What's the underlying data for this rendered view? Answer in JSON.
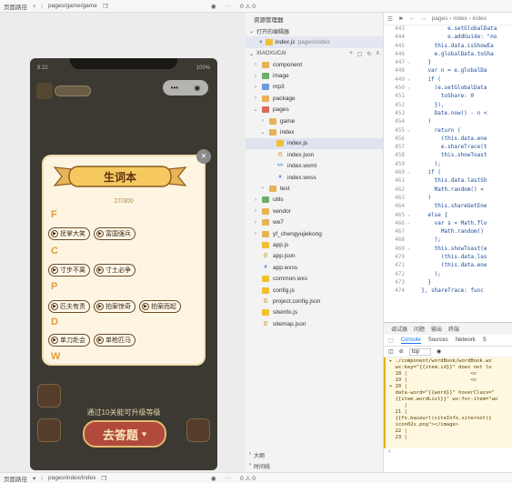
{
  "top_bar": {
    "label": "页面路径",
    "path": "pages/game/game",
    "problems": "0 ⚠ 0"
  },
  "bottom_bar": {
    "label": "页面路径",
    "path": "pages/index/index",
    "problems": "0 ⚠ 0"
  },
  "phone": {
    "time": "8:22",
    "battery": "100%",
    "capsule_menu": "•••",
    "capsule_close": "◉",
    "bottom_text": "通过10关能可升级等级",
    "answer_button": "去答题"
  },
  "vocab_card": {
    "title": "生词本",
    "progress": "27/300",
    "groups": [
      {
        "letter": "F",
        "words": [
          "抚掌大笑",
          "富国强兵"
        ]
      },
      {
        "letter": "C",
        "words": [
          "寸步不离",
          "寸土必争"
        ]
      },
      {
        "letter": "P",
        "words": [
          "匹夫有责",
          "拍案惊奇",
          "拍案而起"
        ]
      },
      {
        "letter": "D",
        "words": [
          "单刀赴会",
          "单枪匹马"
        ]
      },
      {
        "letter": "W",
        "words": []
      }
    ]
  },
  "explorer": {
    "header": "资源管理器",
    "open_editors": "打开的编辑器",
    "open_file_name": "index.js",
    "open_file_path": "pages\\index",
    "project": "XIAOXUCAI",
    "tree": [
      {
        "name": "component",
        "type": "folder",
        "indent": 0,
        "chev": "›"
      },
      {
        "name": "image",
        "type": "folder-green",
        "indent": 0,
        "chev": "›"
      },
      {
        "name": "mp3",
        "type": "folder-blue",
        "indent": 0,
        "chev": "›"
      },
      {
        "name": "package",
        "type": "folder",
        "indent": 0,
        "chev": "›"
      },
      {
        "name": "pages",
        "type": "folder-red",
        "indent": 0,
        "chev": "⌄"
      },
      {
        "name": "game",
        "type": "folder",
        "indent": 1,
        "chev": "›"
      },
      {
        "name": "index",
        "type": "folder",
        "indent": 1,
        "chev": "⌄"
      },
      {
        "name": "index.js",
        "type": "js",
        "indent": 2,
        "chev": "",
        "selected": true
      },
      {
        "name": "index.json",
        "type": "json",
        "indent": 2,
        "chev": ""
      },
      {
        "name": "index.wxml",
        "type": "wxml",
        "indent": 2,
        "chev": ""
      },
      {
        "name": "index.wxss",
        "type": "wxss",
        "indent": 2,
        "chev": ""
      },
      {
        "name": "test",
        "type": "folder",
        "indent": 1,
        "chev": "›"
      },
      {
        "name": "utils",
        "type": "folder-green",
        "indent": 0,
        "chev": "›"
      },
      {
        "name": "vendor",
        "type": "folder",
        "indent": 0,
        "chev": "›"
      },
      {
        "name": "we7",
        "type": "folder",
        "indent": 0,
        "chev": "›"
      },
      {
        "name": "yf_chengyujiekong",
        "type": "folder",
        "indent": 0,
        "chev": "›"
      },
      {
        "name": "app.js",
        "type": "js",
        "indent": 0,
        "chev": ""
      },
      {
        "name": "app.json",
        "type": "json",
        "indent": 0,
        "chev": ""
      },
      {
        "name": "app.wxss",
        "type": "wxss",
        "indent": 0,
        "chev": ""
      },
      {
        "name": "common.wxs",
        "type": "js",
        "indent": 0,
        "chev": ""
      },
      {
        "name": "config.js",
        "type": "js",
        "indent": 0,
        "chev": ""
      },
      {
        "name": "project.config.json",
        "type": "json",
        "indent": 0,
        "chev": ""
      },
      {
        "name": "siteinfo.js",
        "type": "js",
        "indent": 0,
        "chev": ""
      },
      {
        "name": "sitemap.json",
        "type": "json",
        "indent": 0,
        "chev": ""
      }
    ],
    "outline": "大纲",
    "timeline": "时间线"
  },
  "editor": {
    "breadcrumb": "pages › index › index",
    "lines": [
      {
        "n": "443",
        "fold": "",
        "html": "          e.setGlobalData"
      },
      {
        "n": "444",
        "fold": "",
        "html": "          o.addGuide: \"no"
      },
      {
        "n": "445",
        "fold": "",
        "html": "      this.data.isShowEa"
      },
      {
        "n": "446",
        "fold": "",
        "html": "      e.globalData.toSha"
      },
      {
        "n": "447",
        "fold": "⌄",
        "html": "    }"
      },
      {
        "n": "448",
        "fold": "",
        "html": "    var n = e.globalDa"
      },
      {
        "n": "449",
        "fold": "⌄",
        "html": "    if ("
      },
      {
        "n": "450",
        "fold": "⌄",
        "html": "      (e.setGlobalData"
      },
      {
        "n": "451",
        "fold": "",
        "html": "        toShare: 0"
      },
      {
        "n": "452",
        "fold": "",
        "html": "      }),"
      },
      {
        "n": "453",
        "fold": "",
        "html": "      Date.now() - n <"
      },
      {
        "n": "454",
        "fold": "",
        "html": "    )"
      },
      {
        "n": "455",
        "fold": "⌄",
        "html": "      return ("
      },
      {
        "n": "456",
        "fold": "",
        "html": "        (this.data.ene"
      },
      {
        "n": "457",
        "fold": "",
        "html": "        e.shareTrace(t"
      },
      {
        "n": "458",
        "fold": "",
        "html": "        this.showToast"
      },
      {
        "n": "459",
        "fold": "",
        "html": "      );"
      },
      {
        "n": "460",
        "fold": "⌄",
        "html": "    if ("
      },
      {
        "n": "461",
        "fold": "",
        "html": "      this.data.lastSh"
      },
      {
        "n": "462",
        "fold": "",
        "html": "      Math.random() <"
      },
      {
        "n": "463",
        "fold": "",
        "html": "    )"
      },
      {
        "n": "464",
        "fold": "",
        "html": "      this.shareGetEne"
      },
      {
        "n": "465",
        "fold": "⌄",
        "html": "    else {"
      },
      {
        "n": "466",
        "fold": "⌄",
        "html": "      var s = Math.flo"
      },
      {
        "n": "467",
        "fold": "",
        "html": "        Math.random()"
      },
      {
        "n": "468",
        "fold": "",
        "html": "      );"
      },
      {
        "n": "469",
        "fold": "⌄",
        "html": "      this.showToast(e"
      },
      {
        "n": "470",
        "fold": "",
        "html": "        (this.data.las"
      },
      {
        "n": "471",
        "fold": "",
        "html": "        (this.data.ene"
      },
      {
        "n": "472",
        "fold": "",
        "html": "      );"
      },
      {
        "n": "473",
        "fold": "",
        "html": "    }"
      },
      {
        "n": "474",
        "fold": "",
        "html": "  }, shareTrace: func"
      }
    ]
  },
  "debugger": {
    "top_tabs": [
      "调试器",
      "问题",
      "输出",
      "终端"
    ],
    "tabs": [
      "Console",
      "Sources",
      "Network",
      "S"
    ],
    "active_tab": "Console",
    "context": "top",
    "log": "▸ ./component/wordBook/wordBook.wx\n  wx:key=\"{{item.id}}\" does not lo\n  18 |                     <c\n  19 |                     <c\n> 20 |\n  data-word=\"{{word}}\" hoverClass=\"\n  {{item.wordList}}\" wx:for-item=\"wo\n     |\n  21 |\n  {{fn.baseurl(siteInfo.siteroot)}\n  icon02x.png\"></image>\n  22 |\n  23 |",
    "prompt": "›"
  }
}
